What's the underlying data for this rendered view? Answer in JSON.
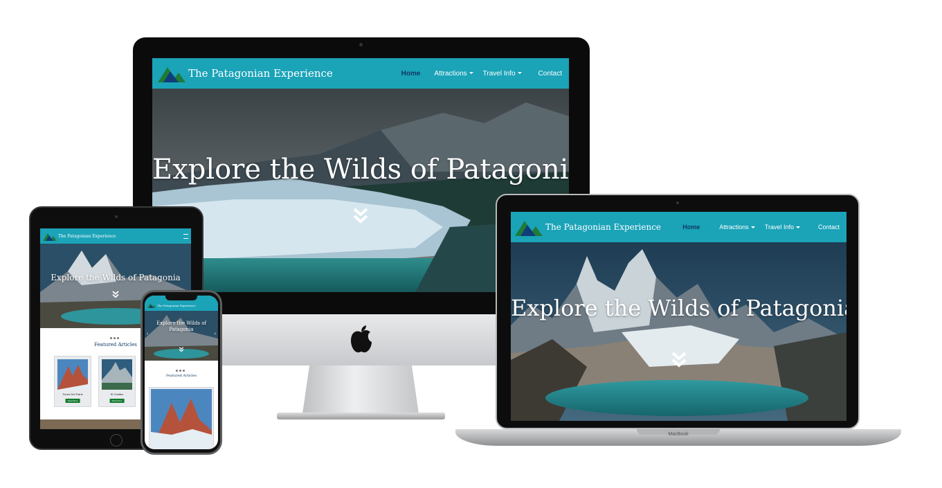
{
  "site": {
    "brand": "The Patagonian Experience",
    "nav": [
      {
        "label": "Home",
        "active": true,
        "dropdown": false
      },
      {
        "label": "Attractions",
        "active": false,
        "dropdown": true
      },
      {
        "label": "Travel Info",
        "active": false,
        "dropdown": true
      },
      {
        "label": "Contact",
        "active": false,
        "dropdown": false
      }
    ],
    "hero_title": "Explore the Wilds of Patagonia",
    "featured_heading": "Featured Articles",
    "cards": [
      {
        "title": "Torres Del Paine",
        "button": "Read More"
      },
      {
        "title": "El Chalten",
        "button": "Read More"
      }
    ]
  },
  "devices": {
    "laptop_label": "MacBook"
  },
  "colors": {
    "navbar": "#1ba3b8",
    "active_link": "#0d3a63",
    "button": "#0f7a2a"
  }
}
